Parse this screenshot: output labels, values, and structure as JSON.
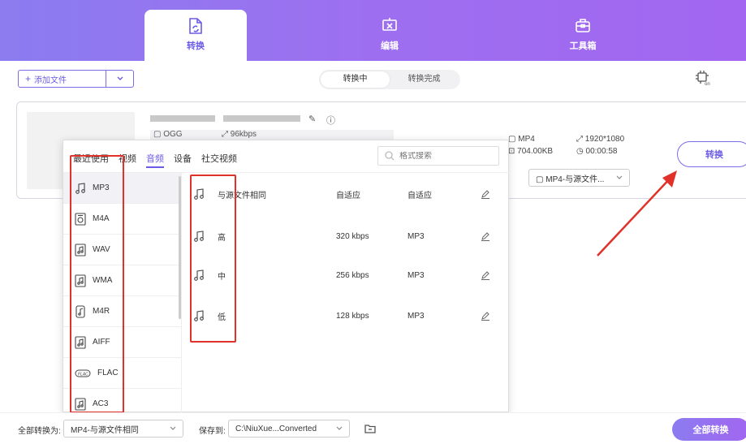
{
  "nav": {
    "tabs": [
      {
        "label": "转换",
        "icon": "file-convert-icon",
        "active": true
      },
      {
        "label": "编辑",
        "icon": "scissors-edit-icon",
        "active": false
      },
      {
        "label": "工具箱",
        "icon": "toolbox-icon",
        "active": false
      }
    ]
  },
  "toolbar": {
    "add_file_label": "添加文件",
    "seg": [
      "转换中",
      "转换完成"
    ]
  },
  "file": {
    "src_format": "OGG",
    "src_bitrate": "96kbps",
    "out_format": "MP4",
    "out_resolution": "1920*1080",
    "out_size": "704.00KB",
    "out_duration": "00:00:58",
    "out_profile": "MP4-与源文件...",
    "convert_label": "转换"
  },
  "popup": {
    "tabs": [
      "最近使用",
      "视频",
      "音频",
      "设备",
      "社交视频"
    ],
    "active_tab": 2,
    "search_placeholder": "格式搜索",
    "formats": [
      "MP3",
      "M4A",
      "WAV",
      "WMA",
      "M4R",
      "AIFF",
      "FLAC",
      "AC3"
    ],
    "qualities": [
      {
        "name": "与源文件相同",
        "bitrate": "自适应",
        "format": "自适应"
      },
      {
        "name": "高",
        "bitrate": "320 kbps",
        "format": "MP3"
      },
      {
        "name": "中",
        "bitrate": "256 kbps",
        "format": "MP3"
      },
      {
        "name": "低",
        "bitrate": "128 kbps",
        "format": "MP3"
      }
    ]
  },
  "bottom": {
    "convert_all_label": "全部转换为:",
    "convert_all_value": "MP4-与源文件相同",
    "save_label": "保存到:",
    "save_path": "C:\\NiuXue...Converted",
    "all_button": "全部转换"
  },
  "colors": {
    "accent": "#6b5ce6",
    "highlight": "#e0322b"
  }
}
